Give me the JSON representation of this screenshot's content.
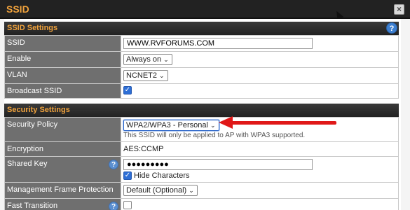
{
  "dialog": {
    "title": "SSID",
    "close_label": "×"
  },
  "ssid_settings": {
    "heading": "SSID Settings",
    "help_label": "?",
    "rows": {
      "ssid": {
        "label": "SSID",
        "value": "WWW.RVFORUMS.COM"
      },
      "enable": {
        "label": "Enable",
        "value": "Always on"
      },
      "vlan": {
        "label": "VLAN",
        "value": "NCNET2"
      },
      "broadcast": {
        "label": "Broadcast SSID",
        "checked": true
      }
    }
  },
  "security_settings": {
    "heading": "Security Settings",
    "rows": {
      "policy": {
        "label": "Security Policy",
        "value": "WPA2/WPA3 - Personal",
        "note": "This SSID will only be applied to AP with WPA3 supported."
      },
      "encryption": {
        "label": "Encryption",
        "value": "AES:CCMP"
      },
      "shared_key": {
        "label": "Shared Key",
        "help_label": "?",
        "value": "●●●●●●●●●",
        "hide_label": "Hide Characters",
        "hide_checked": true
      },
      "mfp": {
        "label": "Management Frame Protection",
        "value": "Default (Optional)"
      },
      "fast_transition": {
        "label": "Fast Transition",
        "help_label": "?",
        "checked": false
      }
    }
  },
  "icons": {
    "check": "✓",
    "chevron": "⌄"
  },
  "colors": {
    "accent": "#f0a23c",
    "label_bg": "#6f6f6f",
    "annotation_arrow": "#e01818",
    "checkbox": "#2e6fd6"
  }
}
